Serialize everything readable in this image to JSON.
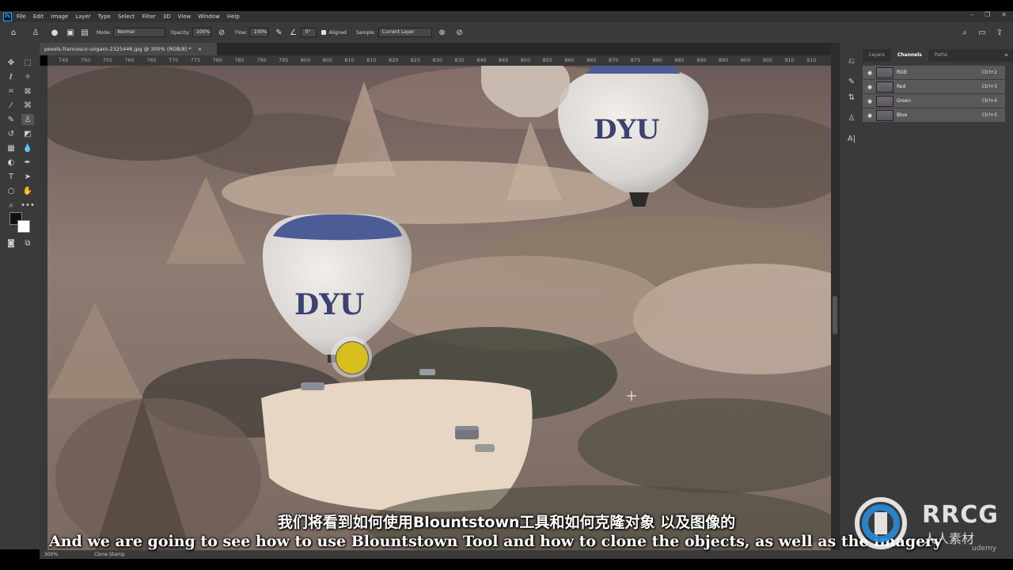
{
  "menu": {
    "app_icon": "Ps",
    "items": [
      "File",
      "Edit",
      "Image",
      "Layer",
      "Type",
      "Select",
      "Filter",
      "3D",
      "View",
      "Window",
      "Help"
    ]
  },
  "options": {
    "mode_label": "Mode:",
    "mode_value": "Normal",
    "opacity_label": "Opacity:",
    "opacity_value": "100%",
    "flow_label": "Flow:",
    "flow_value": "100%",
    "angle_value": "0°",
    "aligned_label": "Aligned",
    "sample_label": "Sample:",
    "sample_value": "Current Layer"
  },
  "document": {
    "tab_title": "pexels-francesco-ungaro-2325446.jpg @ 300% (RGB/8) *",
    "ruler_ticks": [
      "745",
      "750",
      "755",
      "760",
      "765",
      "770",
      "775",
      "780",
      "785",
      "790",
      "795",
      "800",
      "805",
      "810",
      "815",
      "820",
      "825",
      "830",
      "835",
      "840",
      "845",
      "850",
      "855",
      "860",
      "865",
      "870",
      "875",
      "880",
      "885",
      "890",
      "895",
      "900",
      "905",
      "910",
      "915"
    ],
    "balloon_text": "DYU"
  },
  "panel": {
    "tabs": [
      "Layers",
      "Channels",
      "Paths"
    ],
    "active_tab": "Channels",
    "channels": [
      {
        "name": "RGB",
        "shortcut": "Ctrl+2"
      },
      {
        "name": "Red",
        "shortcut": "Ctrl+3"
      },
      {
        "name": "Green",
        "shortcut": "Ctrl+4"
      },
      {
        "name": "Blue",
        "shortcut": "Ctrl+5"
      }
    ]
  },
  "status": {
    "zoom": "300%",
    "tool_name": "Clone Stamp"
  },
  "subtitles": {
    "chinese": "我们将看到如何使用Blountstown工具和如何克隆对象 以及图像的",
    "english": "And we are going to see how to use Blountstown Tool and how to clone the objects, as well as the imagery"
  },
  "watermark": {
    "brand": "RRCG",
    "cn": "人人素材",
    "udemy": "udemy"
  },
  "colors": {
    "cursor_fill": "#d8bf1e",
    "ui_dark": "#3a3a3a",
    "balloon_top": "#4a5890"
  }
}
